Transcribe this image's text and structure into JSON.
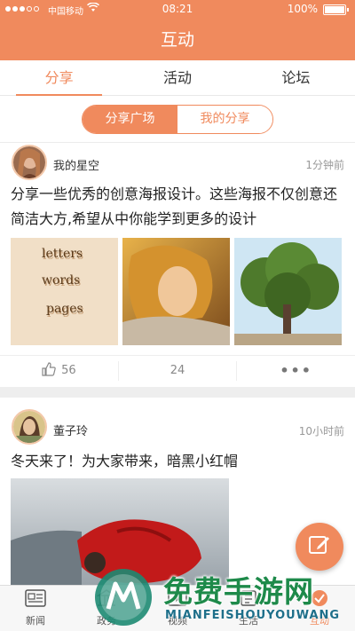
{
  "statusbar": {
    "carrier": "中国移动",
    "time": "08:21",
    "battery": "100%"
  },
  "navbar": {
    "title": "互动"
  },
  "tabs": [
    {
      "label": "分享"
    },
    {
      "label": "活动"
    },
    {
      "label": "论坛"
    }
  ],
  "segment": {
    "options": [
      {
        "label": "分享广场"
      },
      {
        "label": "我的分享"
      }
    ]
  },
  "posts": [
    {
      "username": "我的星空",
      "time": "1分钟前",
      "text": "分享一些优秀的创意海报设计。这些海报不仅创意还简洁大方,希望从中你能学到更多的设计",
      "image1_words": [
        "letters",
        "words",
        "pages"
      ],
      "likes": "56",
      "comments": "24",
      "more": "•••"
    },
    {
      "username": "董子玲",
      "time": "10小时前",
      "text": "冬天来了！为大家带来，暗黑小红帽"
    }
  ],
  "bottom_tabs": [
    {
      "label": "新闻"
    },
    {
      "label": "政务"
    },
    {
      "label": "视频"
    },
    {
      "label": "生活"
    },
    {
      "label": "互动"
    }
  ],
  "watermark": {
    "main": "免费手游网",
    "sub": "MIANFEISHOUYOUWANG"
  },
  "colors": {
    "accent": "#f08a5d",
    "watermark_green": "#1e8a4a"
  }
}
